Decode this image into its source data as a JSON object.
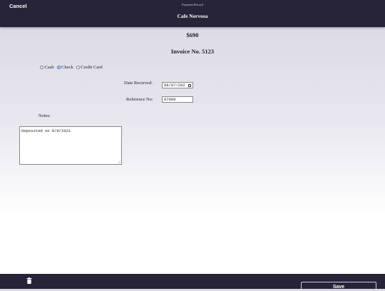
{
  "header": {
    "cancel_label": "Cancel",
    "subtitle": "Payment Record",
    "title": "Cafe Nervosa"
  },
  "amount": "$690",
  "invoice": "Invoice No. 5123",
  "payment_methods": {
    "selected": "Check",
    "options": [
      {
        "label": "Cash",
        "checked": false
      },
      {
        "label": "Check",
        "checked": true
      },
      {
        "label": "Credit Card",
        "checked": false
      }
    ]
  },
  "form": {
    "date_label": "Date Recieved:",
    "date_value": "08/07/202",
    "reference_label": "Reference No:",
    "reference_value": "67890",
    "notes_label": "Notes:",
    "notes_value": "Deposited on 8/9/2021"
  },
  "footer": {
    "delete_icon": "trash-icon",
    "save_label": "Save"
  },
  "colors": {
    "bar_background": "#272339",
    "radio_selected": "#2f6fd6"
  }
}
